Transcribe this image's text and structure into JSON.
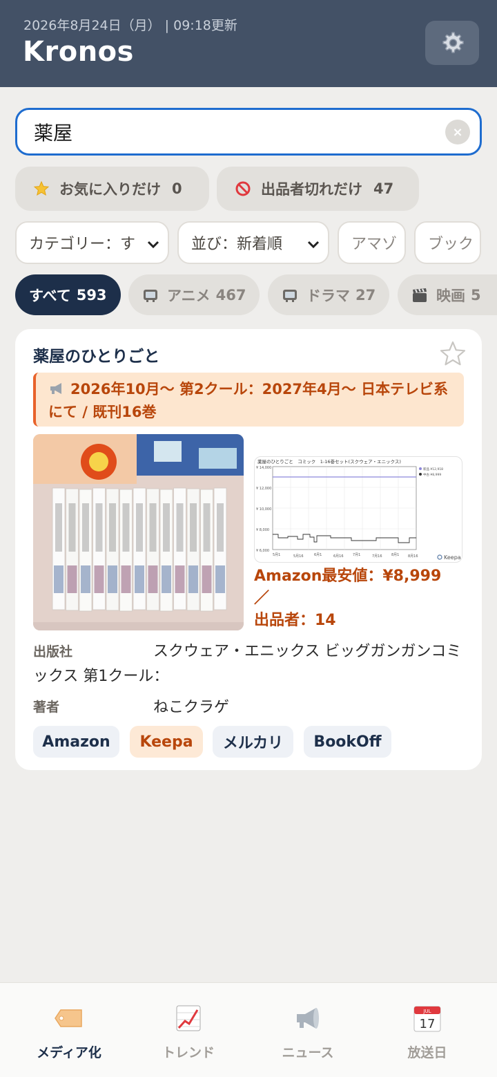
{
  "header": {
    "date": "2026年8月24日（月）",
    "updated": "| 09:18更新",
    "app_title": "Kronos",
    "settings_icon": "gear-icon"
  },
  "search": {
    "value": "薬屋",
    "clear_label": "×"
  },
  "filters": {
    "favorites_label": "お気に入りだけ",
    "favorites_count": "0",
    "sold_out_label": "出品者切れだけ",
    "sold_out_count": "47"
  },
  "dropdowns": {
    "category": "カテゴリー：す",
    "sort": "並び：新着順",
    "store1": "アマゾ",
    "store2": "ブック"
  },
  "categories": [
    {
      "label": "すべて",
      "count": "593"
    },
    {
      "label": "アニメ",
      "count": "467"
    },
    {
      "label": "ドラマ",
      "count": "27"
    },
    {
      "label": "映画",
      "count": "5"
    }
  ],
  "card": {
    "title": "薬屋のひとりごと",
    "notice": "2026年10月〜 第2クール：2027年4月〜 日本テレビ系にて / 既刊16巻",
    "price_line1": "Amazon最安値：¥8,999 ／",
    "price_line2": "出品者：14",
    "publisher_label": "出版社",
    "publisher_value": "スクウェア・エニックス ビッグガンガンコミ",
    "publisher_wrap": "ックス 第1クール：",
    "author_label": "著者",
    "author_value": "ねこクラゲ",
    "links": [
      "Amazon",
      "Keepa",
      "メルカリ",
      "BookOff"
    ],
    "chart_title": "薬屋のひとりごと　コミック　1-16巻セット(スクウェア・エニックス)",
    "chart_legend": [
      "新品 ¥12,918",
      "中古 ¥8,999"
    ],
    "chart_yticks": [
      "¥ 14,000",
      "¥ 12,000",
      "¥ 10,000",
      "¥ 8,000",
      "¥ 6,000"
    ],
    "chart_xticks": [
      "5月1",
      "5月16",
      "6月1",
      "6月16",
      "7月1",
      "7月16",
      "8月1",
      "8月16"
    ],
    "chart_brand": "Keepa",
    "accent": "#b8460b"
  },
  "nav": [
    {
      "label": "メディア化",
      "icon": "tag-icon"
    },
    {
      "label": "トレンド",
      "icon": "trend-chart-icon"
    },
    {
      "label": "ニュース",
      "icon": "megaphone-icon"
    },
    {
      "label": "放送日",
      "icon": "calendar-icon",
      "month": "JUL",
      "day": "17"
    }
  ]
}
